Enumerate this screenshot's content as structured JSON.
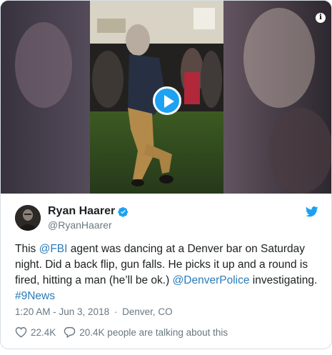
{
  "tweet": {
    "author_name": "Ryan Haarer",
    "author_handle": "@RyanHaarer",
    "text_parts": {
      "p1": "This ",
      "mention_fbi": "@FBI",
      "p2": " agent was dancing at a Denver bar on Saturday night. Did a back flip, gun falls. He picks it up and a round is fired, hitting a man (he’ll be ok.) ",
      "mention_police": "@DenverPolice",
      "p3": " investigating. ",
      "hashtag": "#9News"
    },
    "time": "1:20 AM - Jun 3, 2018",
    "separator": "·",
    "location": "Denver, CO",
    "likes": "22.4K",
    "talking": "20.4K people are talking about this"
  },
  "media": {
    "info_label": "i"
  },
  "colors": {
    "accent": "#1da1f2",
    "link": "#2b7bb9",
    "muted": "#697882",
    "text": "#1c2022",
    "border": "#d6dee4"
  },
  "icons": {
    "play": "play-icon",
    "info": "info-icon",
    "verified": "verified-badge-icon",
    "logo": "twitter-bird-icon",
    "like": "heart-icon",
    "reply": "speech-bubble-icon"
  }
}
